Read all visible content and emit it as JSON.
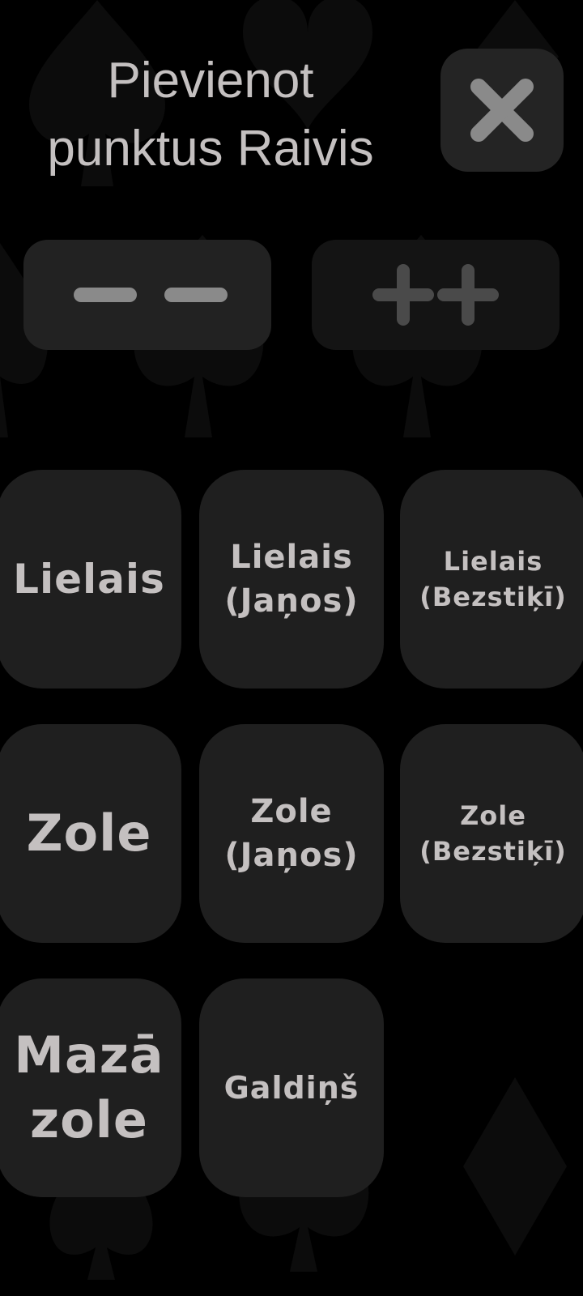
{
  "dialog": {
    "title": "Pievienot\npunktus Raivis",
    "close_icon": "close-icon"
  },
  "controls": {
    "minus_icon": "double-minus-icon",
    "plus_icon": "double-plus-icon"
  },
  "games": [
    {
      "label": "Lielais"
    },
    {
      "label": "Lielais\n(Jaņos)"
    },
    {
      "label": "Lielais\n(Bezstiķī)"
    },
    {
      "label": "Zole"
    },
    {
      "label": "Zole\n(Jaņos)"
    },
    {
      "label": "Zole\n(Bezstiķī)"
    },
    {
      "label": "Mazā\nzole"
    },
    {
      "label": "Galdiņš"
    }
  ],
  "colors": {
    "background": "#000000",
    "button": "#1f1f1f",
    "text": "#c4c0c0"
  }
}
